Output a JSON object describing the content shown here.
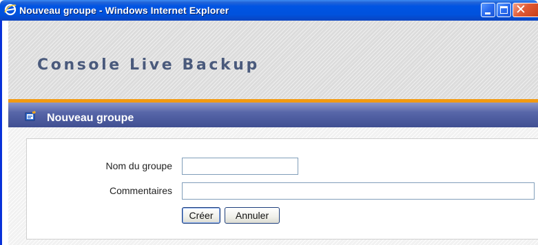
{
  "window": {
    "title": "Nouveau groupe - Windows Internet Explorer",
    "title_icon": "ie-logo-icon",
    "controls": [
      "minimize-icon",
      "maximize-icon",
      "close-icon"
    ],
    "close_glyph": "✕"
  },
  "app": {
    "title": "Console Live Backup"
  },
  "section": {
    "icon": "new-group-icon",
    "title": "Nouveau groupe"
  },
  "form": {
    "name_label": "Nom du groupe",
    "name_value": "",
    "comment_label": "Commentaires",
    "comment_value": "",
    "create_label": "Créer",
    "cancel_label": "Annuler"
  },
  "colors": {
    "accent_orange": "#f29a10",
    "section_bar": "#4c5b9e",
    "app_title": "#4a5a7c",
    "titlebar": "#0054e3"
  }
}
